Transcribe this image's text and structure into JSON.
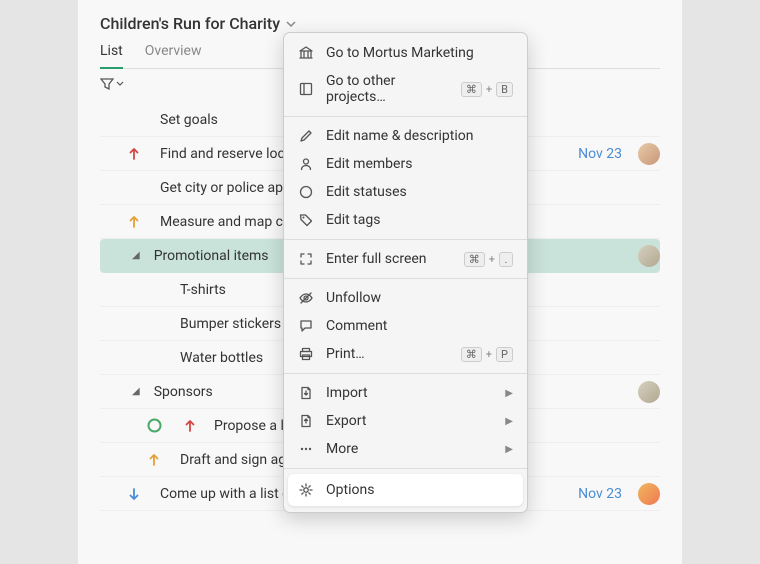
{
  "header": {
    "title": "Children's Run for Charity"
  },
  "tabs": [
    {
      "label": "List",
      "active": true
    },
    {
      "label": "Overview",
      "active": false
    }
  ],
  "tasks": [
    {
      "title": "Set goals",
      "indent": 0
    },
    {
      "title": "Find and reserve location",
      "indent": 0,
      "priority": "red-up",
      "date": "Nov 23",
      "avatar": "av1"
    },
    {
      "title": "Get city or police approval",
      "indent": 0
    },
    {
      "title": "Measure and map course",
      "indent": 0,
      "priority": "orange-up"
    },
    {
      "title": "Promotional items",
      "indent": 0,
      "disclosure": true,
      "selected": true,
      "avatar": "av2"
    },
    {
      "title": "T-shirts",
      "indent": 1
    },
    {
      "title": "Bumper stickers",
      "indent": 1
    },
    {
      "title": "Water bottles",
      "indent": 1
    },
    {
      "title": "Sponsors",
      "indent": 0,
      "disclosure": true,
      "avatar": "av2"
    },
    {
      "title": "Propose a list of potential sponsors",
      "indent": 1,
      "priority": "green-ring",
      "priority2": "red-up"
    },
    {
      "title": "Draft and sign agreements",
      "indent": 1,
      "priority": "orange-up"
    },
    {
      "title": "Come up with a list of volunteer needs",
      "indent": 0,
      "priority": "blue-down",
      "date": "Nov 23",
      "avatar": "av3"
    }
  ],
  "menu": {
    "groups": [
      [
        {
          "icon": "bank",
          "label": "Go to Mortus Marketing"
        },
        {
          "icon": "projects",
          "label": "Go to other projects…",
          "shortcut": [
            "⌘",
            "B"
          ]
        }
      ],
      [
        {
          "icon": "pencil",
          "label": "Edit name & description"
        },
        {
          "icon": "person",
          "label": "Edit members"
        },
        {
          "icon": "circle",
          "label": "Edit statuses"
        },
        {
          "icon": "tag",
          "label": "Edit tags"
        }
      ],
      [
        {
          "icon": "fullscreen",
          "label": "Enter full screen",
          "shortcut": [
            "⌘",
            "."
          ]
        }
      ],
      [
        {
          "icon": "eye-off",
          "label": "Unfollow"
        },
        {
          "icon": "comment",
          "label": "Comment"
        },
        {
          "icon": "print",
          "label": "Print…",
          "shortcut": [
            "⌘",
            "P"
          ]
        }
      ],
      [
        {
          "icon": "import",
          "label": "Import",
          "submenu": true
        },
        {
          "icon": "export",
          "label": "Export",
          "submenu": true
        },
        {
          "icon": "more",
          "label": "More",
          "submenu": true
        }
      ],
      [
        {
          "icon": "gear",
          "label": "Options",
          "highlighted": true
        }
      ]
    ]
  }
}
